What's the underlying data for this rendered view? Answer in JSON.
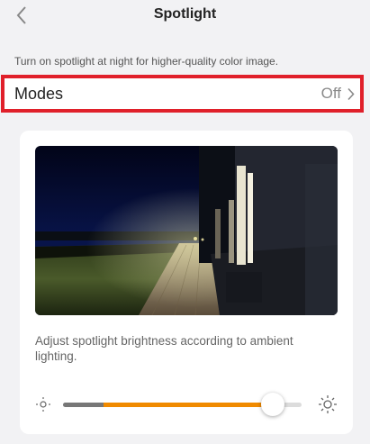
{
  "header": {
    "title": "Spotlight",
    "back_icon": "chevron-left-icon"
  },
  "description": "Turn on spotlight at night for higher-quality color image.",
  "modes": {
    "label": "Modes",
    "value": "Off",
    "icon": "chevron-right-icon"
  },
  "card": {
    "preview_image": "night camera view of patio and lawn lit by spotlight",
    "text": "Adjust spotlight brightness according to ambient lighting.",
    "brightness": {
      "min_icon": "sun-small-icon",
      "max_icon": "sun-large-icon",
      "value_percent": 88,
      "colors": {
        "active": "#f08a00",
        "track": "#dcdcdc",
        "segment": "#777777"
      }
    }
  },
  "colors": {
    "highlight_border": "#e0202a",
    "background": "#f2f2f4"
  }
}
